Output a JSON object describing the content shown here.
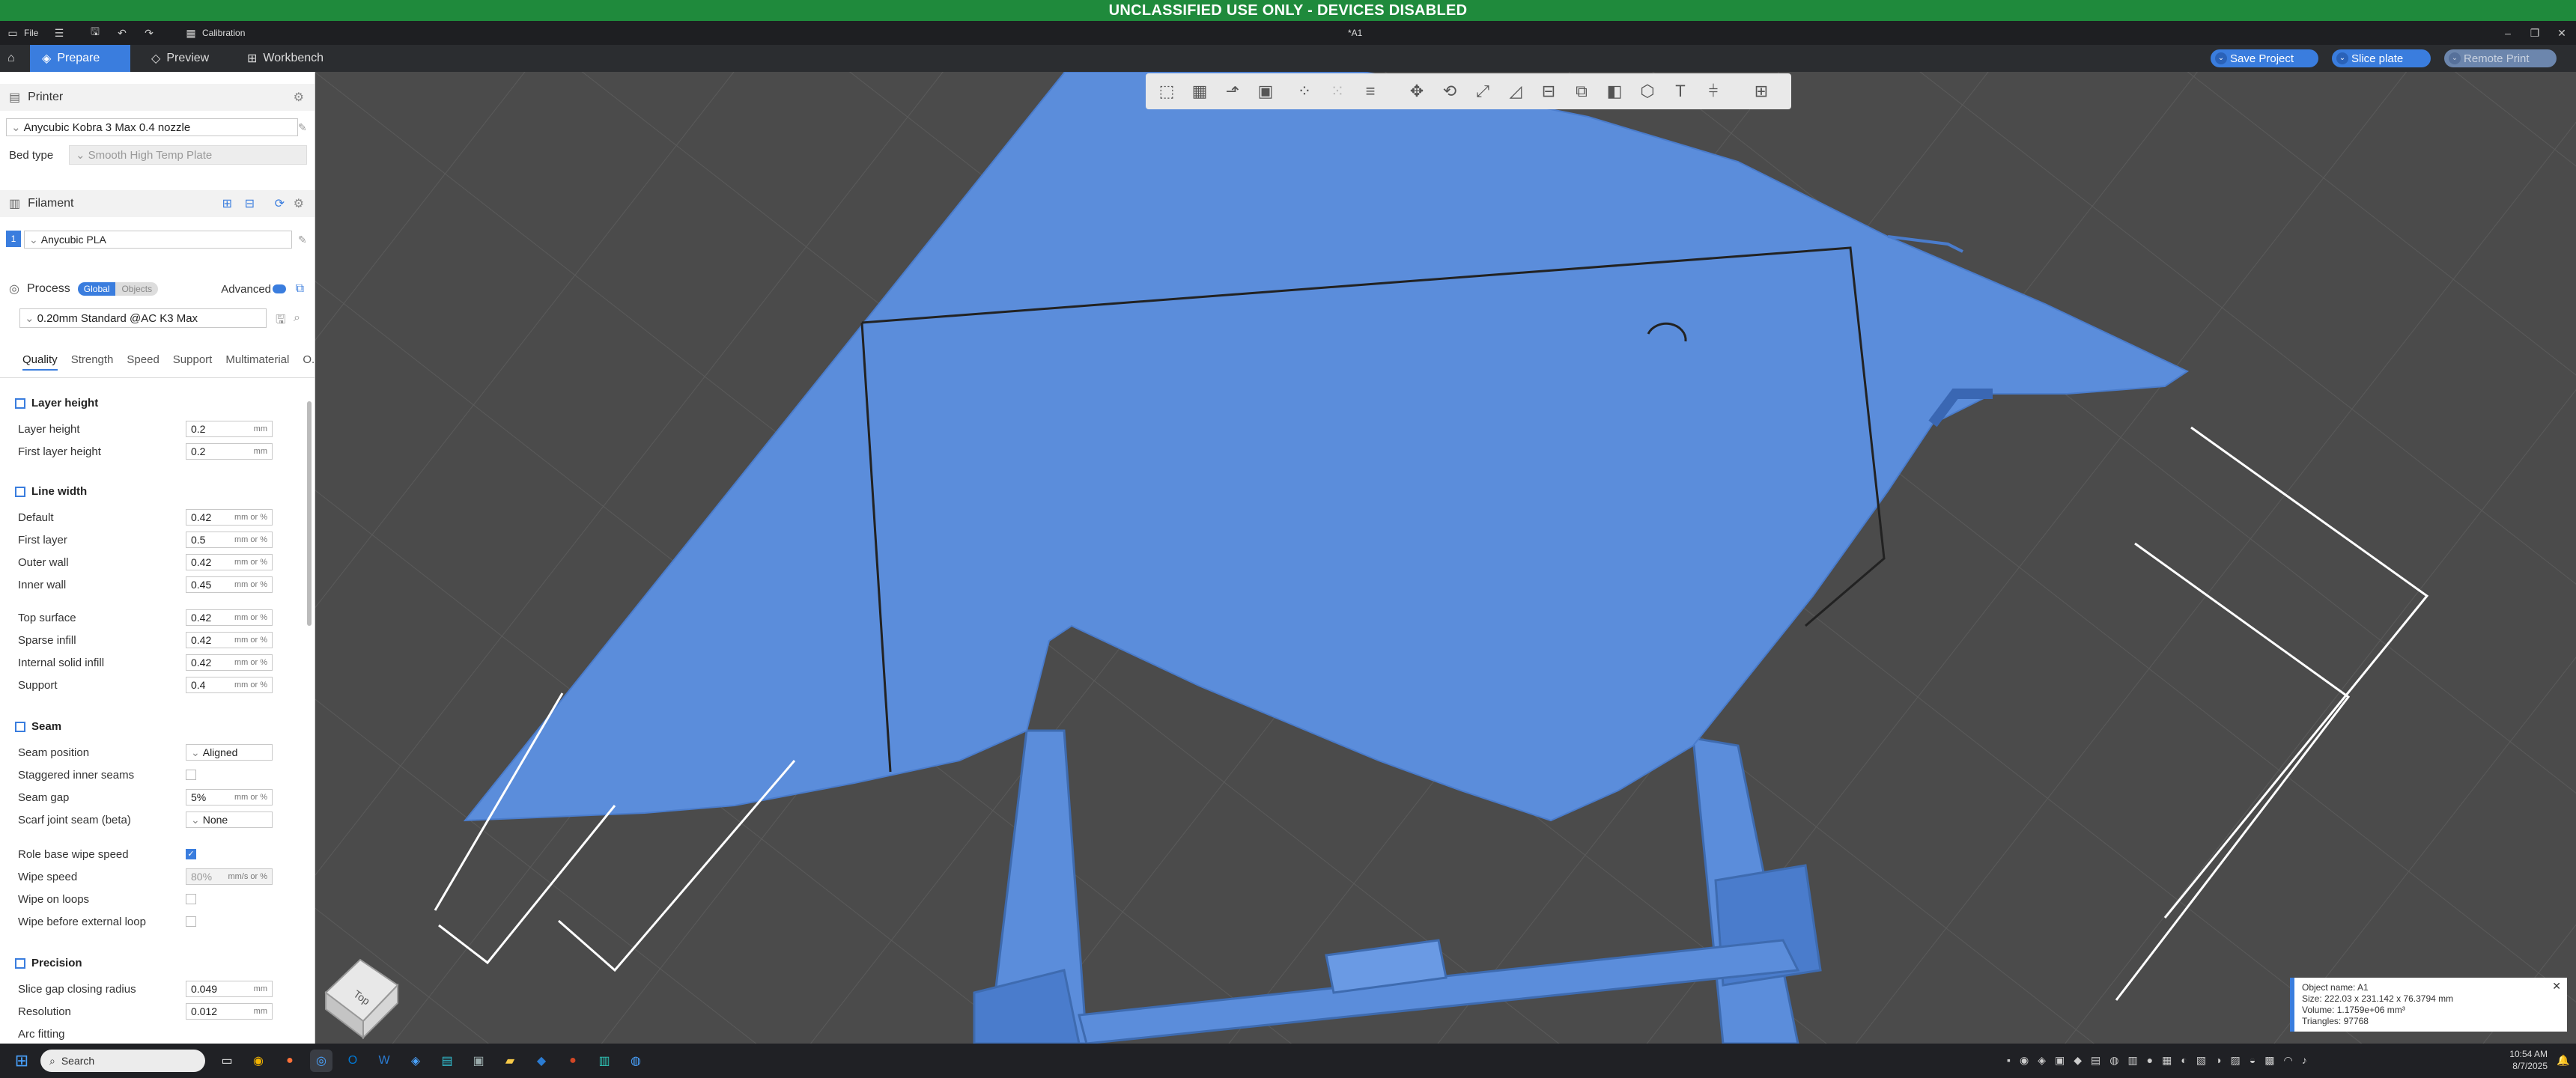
{
  "banner": "UNCLASSIFIED USE ONLY - DEVICES DISABLED",
  "titlebar": {
    "file_label": "File",
    "calibration_label": "Calibration",
    "doc_title": "*A1"
  },
  "menubar": {
    "tabs": [
      {
        "label": "Prepare",
        "icon": "cube-icon"
      },
      {
        "label": "Preview",
        "icon": "layers-icon"
      },
      {
        "label": "Workbench",
        "icon": "grid-icon"
      }
    ],
    "save_project": "Save Project",
    "slice_plate": "Slice plate",
    "remote_print": "Remote Print"
  },
  "printer": {
    "title": "Printer",
    "name": "Anycubic Kobra 3 Max 0.4 nozzle",
    "bed_type_label": "Bed type",
    "bed_type": "Smooth High Temp Plate"
  },
  "filament": {
    "title": "Filament",
    "slot": "1",
    "name": "Anycubic PLA"
  },
  "process": {
    "title": "Process",
    "toggle_global": "Global",
    "toggle_objects": "Objects",
    "advanced_label": "Advanced",
    "preset": "0.20mm Standard @AC K3 Max",
    "tabs": [
      "Quality",
      "Strength",
      "Speed",
      "Support",
      "Multimaterial",
      "O.."
    ]
  },
  "quality": {
    "layer_height": {
      "title": "Layer height",
      "rows": [
        {
          "label": "Layer height",
          "value": "0.2",
          "unit": "mm"
        },
        {
          "label": "First layer height",
          "value": "0.2",
          "unit": "mm"
        }
      ]
    },
    "line_width": {
      "title": "Line width",
      "rows": [
        {
          "label": "Default",
          "value": "0.42",
          "unit": "mm or %"
        },
        {
          "label": "First layer",
          "value": "0.5",
          "unit": "mm or %"
        },
        {
          "label": "Outer wall",
          "value": "0.42",
          "unit": "mm or %"
        },
        {
          "label": "Inner wall",
          "value": "0.45",
          "unit": "mm or %"
        },
        {
          "label": "Top surface",
          "value": "0.42",
          "unit": "mm or %"
        },
        {
          "label": "Sparse infill",
          "value": "0.42",
          "unit": "mm or %"
        },
        {
          "label": "Internal solid infill",
          "value": "0.42",
          "unit": "mm or %"
        },
        {
          "label": "Support",
          "value": "0.4",
          "unit": "mm or %"
        }
      ]
    },
    "seam": {
      "title": "Seam",
      "seam_position_label": "Seam position",
      "seam_position": "Aligned",
      "staggered_label": "Staggered inner seams",
      "seam_gap_label": "Seam gap",
      "seam_gap": "5%",
      "seam_gap_unit": "mm or %",
      "scarf_label": "Scarf joint seam (beta)",
      "scarf_value": "None",
      "role_wipe_label": "Role base wipe speed",
      "wipe_speed_label": "Wipe speed",
      "wipe_speed": "80%",
      "wipe_speed_unit": "mm/s or %",
      "wipe_loops_label": "Wipe on loops",
      "wipe_before_label": "Wipe before external loop"
    },
    "precision": {
      "title": "Precision",
      "slice_gap_label": "Slice gap closing radius",
      "slice_gap": "0.049",
      "resolution_label": "Resolution",
      "resolution": "0.012",
      "unit": "mm",
      "arc_label": "Arc fitting"
    }
  },
  "object_info": {
    "name": "Object name: A1",
    "size": "Size: 222.03 x 231.142 x 76.3794 mm",
    "volume": "Volume: 1.1759e+06 mm³",
    "triangles": "Triangles: 97768"
  },
  "view_cube_label": "Top",
  "taskbar": {
    "search_placeholder": "Search",
    "time": "10:54 AM",
    "date": "8/7/2025"
  },
  "colors": {
    "accent": "#3a7dde",
    "banner": "#1f8a3c",
    "model": "#5b8ddb"
  }
}
